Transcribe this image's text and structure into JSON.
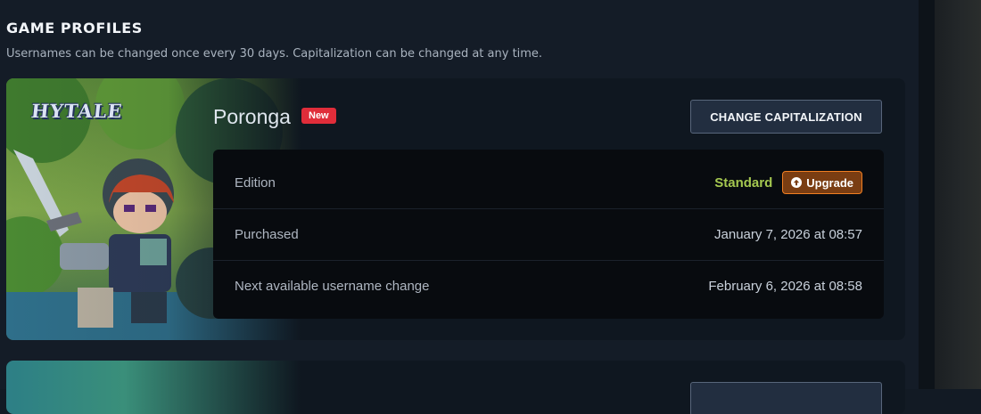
{
  "section": {
    "title": "GAME PROFILES",
    "description": "Usernames can be changed once every 30 days. Capitalization can be changed at any time."
  },
  "profile": {
    "game_logo": "HYTALE",
    "name": "Poronga",
    "badge": "New",
    "change_capitalization_label": "CHANGE CAPITALIZATION",
    "rows": [
      {
        "label": "Edition",
        "value": "Standard",
        "action": "Upgrade",
        "action_icon": "arrow-up-circle-icon"
      },
      {
        "label": "Purchased",
        "value": "January 7, 2026 at 08:57"
      },
      {
        "label": "Next available username change",
        "value": "February 6, 2026 at 08:58"
      }
    ]
  },
  "colors": {
    "accent_new": "#e02d3a",
    "edition_standard": "#a5c850",
    "upgrade_border": "#f07f22",
    "page_background": "#141c27"
  }
}
